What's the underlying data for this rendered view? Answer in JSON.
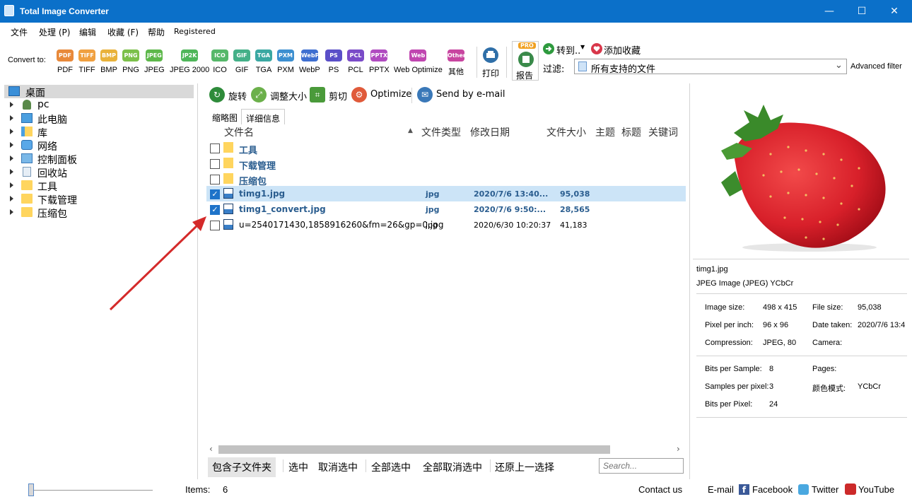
{
  "window": {
    "title": "Total Image Converter"
  },
  "menu": [
    "文件",
    "处理 (P)",
    "编辑",
    "收藏 (F)",
    "帮助",
    "Registered"
  ],
  "toolbar": {
    "convert_to_label": "Convert to:",
    "formats": [
      {
        "badge": "PDF",
        "label": "PDF",
        "color": "#e8893a"
      },
      {
        "badge": "TIFF",
        "label": "TIFF",
        "color": "#f0a040"
      },
      {
        "badge": "BMP",
        "label": "BMP",
        "color": "#e9b23a"
      },
      {
        "badge": "PNG",
        "label": "PNG",
        "color": "#7cc04a"
      },
      {
        "badge": "JPEG",
        "label": "JPEG",
        "color": "#5db84a"
      },
      {
        "badge": "JP2K",
        "label": "JPEG 2000",
        "color": "#4fb65a"
      },
      {
        "badge": "ICO",
        "label": "ICO",
        "color": "#56b86a"
      },
      {
        "badge": "GIF",
        "label": "GIF",
        "color": "#44b088"
      },
      {
        "badge": "TGA",
        "label": "TGA",
        "color": "#3aa8a2"
      },
      {
        "badge": "PXM",
        "label": "PXM",
        "color": "#3c8fd0"
      },
      {
        "badge": "WebP",
        "label": "WebP",
        "color": "#3e6fd0"
      },
      {
        "badge": "PS",
        "label": "PS",
        "color": "#5a4fc8"
      },
      {
        "badge": "PCL",
        "label": "PCL",
        "color": "#7a4bc8"
      },
      {
        "badge": "PPTX",
        "label": "PPTX",
        "color": "#b04bc0"
      },
      {
        "badge": "Web",
        "label": "Web Optimize",
        "color": "#c046b0"
      },
      {
        "badge": "Other",
        "label": "其他",
        "color": "#c845a0"
      }
    ],
    "print_label": "打印",
    "report_label": "报告",
    "pro_badge": "PRO",
    "goto_label": "转到..",
    "favorite_label": "添加收藏",
    "filter_label": "过滤:",
    "filter_value": "所有支持的文件",
    "advanced_filter": "Advanced filter"
  },
  "tree": [
    {
      "label": "桌面",
      "icon": "desktop-icon",
      "selected": true
    },
    {
      "label": "pc",
      "icon": "user-icon"
    },
    {
      "label": "此电脑",
      "icon": "computer-icon"
    },
    {
      "label": "库",
      "icon": "library-icon"
    },
    {
      "label": "网络",
      "icon": "network-icon"
    },
    {
      "label": "控制面板",
      "icon": "control-panel-icon"
    },
    {
      "label": "回收站",
      "icon": "recycle-bin-icon"
    },
    {
      "label": "工具",
      "icon": "folder-icon"
    },
    {
      "label": "下载管理",
      "icon": "folder-icon"
    },
    {
      "label": "压缩包",
      "icon": "folder-icon"
    }
  ],
  "actions": [
    {
      "label": "旋转",
      "icon": "rotate-icon",
      "color": "#2e8b3a"
    },
    {
      "label": "调整大小",
      "icon": "resize-icon",
      "color": "#6bb04a"
    },
    {
      "label": "剪切",
      "icon": "crop-icon",
      "color": "#4a9a3a"
    },
    {
      "label": "Optimize",
      "icon": "gear-icon",
      "color": "#e05a3a"
    },
    {
      "label": "Send by e-mail",
      "icon": "email-icon",
      "color": "#3a78b8"
    }
  ],
  "tabs": [
    "缩略图",
    "详细信息"
  ],
  "columns": [
    "文件名",
    "文件类型",
    "修改日期",
    "文件大小",
    "主题",
    "标题",
    "关键词"
  ],
  "files": [
    {
      "name": "工具",
      "type": "",
      "date": "",
      "size": "",
      "folder": true,
      "checked": false
    },
    {
      "name": "下载管理",
      "type": "",
      "date": "",
      "size": "",
      "folder": true,
      "checked": false
    },
    {
      "name": "压缩包",
      "type": "",
      "date": "",
      "size": "",
      "folder": true,
      "checked": false
    },
    {
      "name": "timg1.jpg",
      "type": "jpg",
      "date": "2020/7/6 13:40...",
      "size": "95,038",
      "folder": false,
      "checked": true
    },
    {
      "name": "timg1_convert.jpg",
      "type": "jpg",
      "date": "2020/7/6 9:50:...",
      "size": "28,565",
      "folder": false,
      "checked": true
    },
    {
      "name": "u=2540171430,1858916260&fm=26&gp=0.jpg",
      "type": "jpg",
      "date": "2020/6/30 10:20:37",
      "size": "41,183",
      "folder": false,
      "checked": false
    }
  ],
  "bottom": {
    "include_subfolders": "包含子文件夹",
    "select": "选中",
    "deselect": "取消选中",
    "select_all": "全部选中",
    "deselect_all": "全部取消选中",
    "restore": "还原上一选择",
    "search_placeholder": "Search..."
  },
  "preview": {
    "filename": "timg1.jpg",
    "format": "JPEG Image (JPEG) YCbCr",
    "props_left": [
      {
        "k": "Image size:",
        "v": "498 x 415"
      },
      {
        "k": "Pixel per inch:",
        "v": "96 x 96"
      },
      {
        "k": "Compression:",
        "v": "JPEG, 80"
      }
    ],
    "props_right": [
      {
        "k": "File size:",
        "v": "95,038"
      },
      {
        "k": "Date taken:",
        "v": "2020/7/6 13:4"
      },
      {
        "k": "Camera:",
        "v": ""
      }
    ],
    "props2_left": [
      {
        "k": "Bits per Sample:",
        "v": "8"
      },
      {
        "k": "Samples per pixel:",
        "v": "3"
      },
      {
        "k": "Bits per Pixel:",
        "v": "24"
      }
    ],
    "props2_right": [
      {
        "k": "Pages:",
        "v": ""
      },
      {
        "k": "颜色模式:",
        "v": "YCbCr"
      }
    ]
  },
  "status": {
    "items_label": "Items:",
    "items_count": "6",
    "contact": "Contact us",
    "email": "E-mail",
    "facebook": "Facebook",
    "twitter": "Twitter",
    "youtube": "YouTube"
  }
}
